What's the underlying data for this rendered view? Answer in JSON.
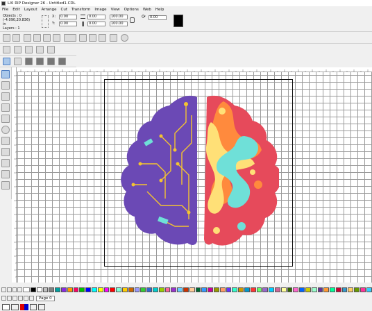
{
  "window": {
    "title": "LXI RIP Designer 26 - Untitled1.CDL"
  },
  "menu": [
    "File",
    "Edit",
    "Layout",
    "Arrange",
    "Cut",
    "Transform",
    "Image",
    "View",
    "Options",
    "Web",
    "Help"
  ],
  "props": {
    "objects": "Objects : 0",
    "coords": "(-4.090,20.836)",
    "units": "in",
    "layers": "Layers : 1",
    "x_label": "X:",
    "x_value": "0.00",
    "y_label": "Y:",
    "y_value": "0.00",
    "w_value": "0.00",
    "h_value": "0.00",
    "sx_value": "100.00",
    "sy_value": "100.00",
    "angle_value": "0.00"
  },
  "page_tab": "Page 0",
  "colors": {
    "brain_left": "#6b49b5",
    "brain_right": "#e64a5b",
    "circuit": "#f4c430",
    "accent_cyan": "#6fe0d8",
    "accent_yellow": "#ffe077",
    "accent_orange": "#ff8a3d"
  },
  "palette": [
    "#000000",
    "#ffffff",
    "#c0c0c0",
    "#808080",
    "#00a0a0",
    "#8a2be2",
    "#ff9900",
    "#ff0066",
    "#00c000",
    "#0000ff",
    "#00ffff",
    "#ffff00",
    "#ff00ff",
    "#ff0000",
    "#7fffd4",
    "#ffcc00",
    "#cc6600",
    "#9999ff",
    "#33cc33",
    "#3366cc",
    "#00cccc",
    "#99cc00",
    "#ff6699",
    "#9933cc",
    "#66ccff",
    "#cc3300",
    "#ffcc99",
    "#006633",
    "#3399ff",
    "#cc0099",
    "#999900",
    "#ff9966",
    "#6633ff",
    "#33ffcc",
    "#cc9900",
    "#0099cc",
    "#ff3333",
    "#66ff66",
    "#9966cc",
    "#00ccff",
    "#cc6699",
    "#ffff99",
    "#336600",
    "#ff66cc",
    "#0066ff",
    "#cccc00",
    "#99ffcc",
    "#663399",
    "#ff9933",
    "#00ff99",
    "#cc0033",
    "#3399cc",
    "#ffcc66",
    "#669900",
    "#ff3399",
    "#33ccff"
  ]
}
